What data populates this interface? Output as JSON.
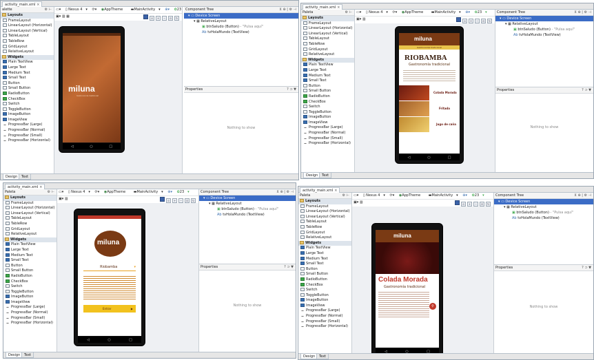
{
  "ide": {
    "file_tab": "activity_main.xml",
    "close_glyph": "×",
    "palette_title": "Palette",
    "palette_short": "alette",
    "palette_title_small": "Paleta",
    "palette_icons": "⚙ ⊢",
    "toolbar": {
      "device": "Nexus 4",
      "theme": "AppTheme",
      "activity": "MainActivity",
      "api": "23"
    },
    "component_tree_title": "Component Tree",
    "component_tree_small": "Component Tree",
    "tree": {
      "device_screen": "Device Screen",
      "relative_layout": "RelativeLayout",
      "button_item": "btnSaludo (Button)",
      "button_hint": "- \"Pulsa aquí\"",
      "textview_item": "tvHolaMundo (TextView)"
    },
    "properties_title": "Properties",
    "nothing_to_show": "Nothing to show",
    "tab_design": "Design",
    "tab_text": "Text",
    "palette_items": [
      {
        "label": "Layouts",
        "cat": true
      },
      {
        "label": "FrameLayout"
      },
      {
        "label": "LinearLayout (Horizontal)"
      },
      {
        "label": "LinearLayout (Vertical)"
      },
      {
        "label": "TableLayout"
      },
      {
        "label": "TableRow"
      },
      {
        "label": "GridLayout"
      },
      {
        "label": "RelativeLayout"
      },
      {
        "label": "Widgets",
        "cat": true
      },
      {
        "label": "Plain TextView"
      },
      {
        "label": "Large Text"
      },
      {
        "label": "Medium Text"
      },
      {
        "label": "Small Text"
      },
      {
        "label": "Button"
      },
      {
        "label": "Small Button"
      },
      {
        "label": "RadioButton"
      },
      {
        "label": "CheckBox"
      },
      {
        "label": "Switch"
      },
      {
        "label": "ToggleButton"
      },
      {
        "label": "ImageButton"
      },
      {
        "label": "ImageView"
      },
      {
        "label": "ProgressBar (Large)"
      },
      {
        "label": "ProgressBar (Normal)"
      },
      {
        "label": "ProgressBar (Small)"
      },
      {
        "label": "ProgressBar (Horizontal)"
      }
    ]
  },
  "app": {
    "logo": "miluna",
    "subtitle": "Gastronomía tradicional",
    "city": "RIOBAMBA",
    "city_sub": "Gastronomía tradicional",
    "dish1": "Colada Morada",
    "dish2": "Fritada",
    "dish3": "Jugo de caña",
    "home_dropdown": "Riobamba",
    "enter_button": "Entrar",
    "detail_title": "Colada Morada",
    "detail_sub": "Gastronomía tradicional",
    "nav_back": "◁",
    "nav_home": "○",
    "nav_recent": "□"
  }
}
